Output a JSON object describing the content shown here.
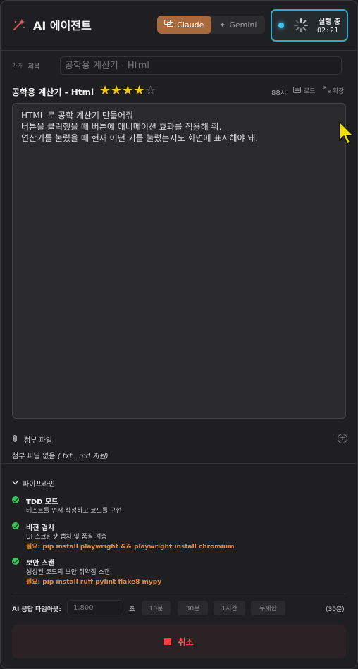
{
  "header": {
    "app_title": "AI 에이전트",
    "models": [
      {
        "label": "Claude",
        "active": true
      },
      {
        "label": "Gemini",
        "active": false
      }
    ],
    "run_status": {
      "label": "실행 중",
      "elapsed": "02:21"
    }
  },
  "title_field": {
    "small_icon_text": "가가",
    "label": "제목",
    "placeholder": "공학용 계산기 - Html"
  },
  "prompt": {
    "title": "공학용 계산기 - Html",
    "rating": 4,
    "rating_max": 5,
    "stars_filled": "★★★★",
    "stars_empty": "☆",
    "char_count": "88자",
    "load_label": "로드",
    "expand_label": "확장",
    "body": "HTML 로 공학 계산기 만들어줘\n버튼을 클릭했을 때 버튼에 애니메이션 효과를 적용해 줘.\n연산키를 눌렀을 때 현재 어떤 키를 눌렀는지도 화면에 표시해야 돼."
  },
  "attachments": {
    "label": "첨부 파일",
    "empty_text": "첨부 파일 없음",
    "supported": "(.txt, .md 지원)"
  },
  "pipeline": {
    "label": "파이프라인",
    "steps": [
      {
        "name": "TDD 모드",
        "desc": "테스트를 먼저 작성하고 코드를 구현",
        "req": ""
      },
      {
        "name": "비전 검사",
        "desc": "UI 스크린샷 캡처 및 품질 검증",
        "req": "필요: pip install playwright && playwright install chromium"
      },
      {
        "name": "보안 스캔",
        "desc": "생성된 코드의 보안 취약점 스캔",
        "req": "필요: pip install ruff pylint flake8 mypy"
      }
    ]
  },
  "timeout": {
    "label": "AI 응답 타임아웃:",
    "placeholder": "1,800",
    "unit": "초",
    "presets": [
      "10분",
      "30분",
      "1시간",
      "무제한"
    ],
    "current": "(30분)"
  },
  "cancel": {
    "label": "취소"
  },
  "colors": {
    "accent_claude": "#a86a3c",
    "running_border": "#3aa6c9",
    "check_green": "#34c759",
    "requirement_orange": "#e8892c",
    "cancel_red": "#ff4d4d",
    "star_gold": "#f5c518"
  }
}
